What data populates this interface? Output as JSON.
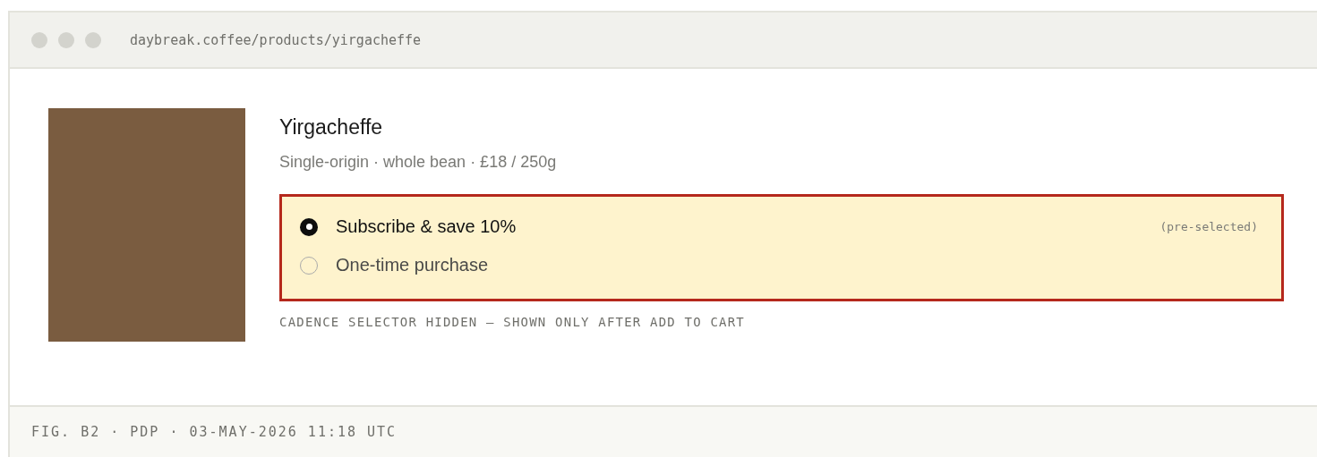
{
  "browser": {
    "url": "daybreak.coffee/products/yirgacheffe"
  },
  "product": {
    "title": "Yirgacheffe",
    "subtitle": "Single-origin · whole bean · £18 / 250g"
  },
  "purchase_options": [
    {
      "label": "Subscribe & save 10%",
      "selected": true,
      "note": "(pre-selected)"
    },
    {
      "label": "One-time purchase",
      "selected": false
    }
  ],
  "caption": "CADENCE SELECTOR HIDDEN — SHOWN ONLY AFTER ADD TO CART",
  "footer": "FIG. B2 · PDP · 03-MAY-2026 11:18 UTC"
}
